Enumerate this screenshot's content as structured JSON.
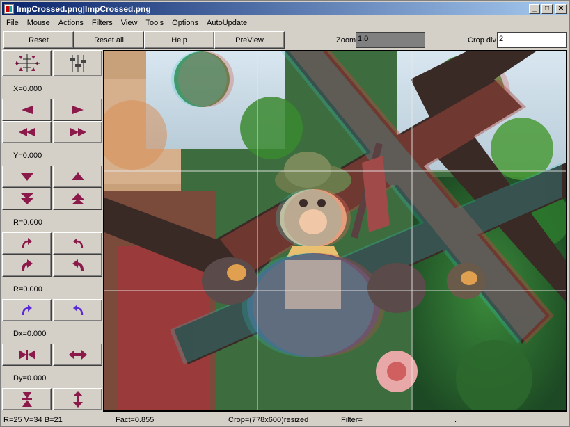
{
  "window": {
    "title": "ImpCrossed.png|ImpCrossed.png",
    "minimize_glyph": "_",
    "maximize_glyph": "□",
    "close_glyph": "✕"
  },
  "menu": [
    "File",
    "Mouse",
    "Actions",
    "Filters",
    "View",
    "Tools",
    "Options",
    "AutoUpdate"
  ],
  "toolbar": {
    "reset": "Reset",
    "reset_all": "Reset all",
    "help": "Help",
    "preview": "PreView",
    "zoom_label": "Zoom",
    "zoom_value": "1.0",
    "crop_label": "Crop div",
    "crop_value": "2"
  },
  "panel": {
    "x_label": "X=0.000",
    "y_label": "Y=0.000",
    "r1_label": "R=0.000",
    "r2_label": "R=0.000",
    "dx_label": "Dx=0.000",
    "dy_label": "Dy=0.000"
  },
  "colors": {
    "arrow": "#8b1a4a",
    "arrow_blue": "#5a2ad8",
    "titlebar_start": "#0a246a",
    "titlebar_end": "#a6caf0"
  },
  "status": {
    "rgb": "R=25 V=34 B=21",
    "fact": "Fact=0.855",
    "crop": "Crop=(778x600)resized",
    "filter": "Filter=",
    "dot": "."
  }
}
